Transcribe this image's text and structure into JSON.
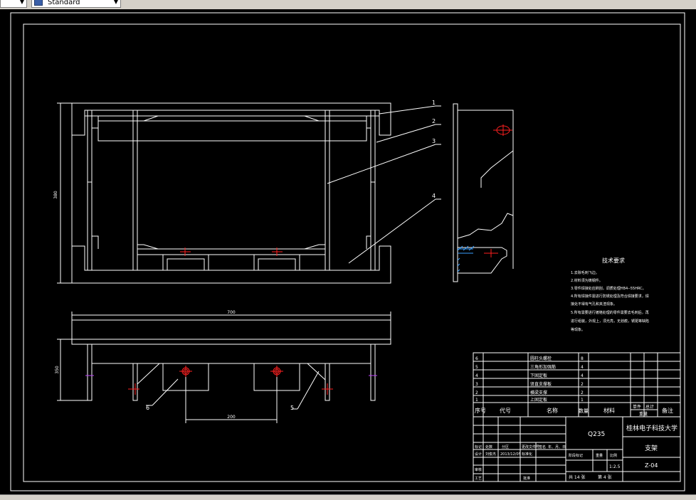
{
  "toolbar": {
    "style_dropdown_value": "Standard"
  },
  "drawing": {
    "part_labels": [
      "1",
      "2",
      "3",
      "4",
      "5",
      "6"
    ],
    "dimensions": {
      "height_top_view": "380",
      "total_length": "700",
      "side_height": "350",
      "hole_spacing": "200"
    },
    "tech_requirements": {
      "title": "技术要求",
      "lines": [
        "1.去除毛刺飞边。",
        "2.材料须为铸钢件。",
        "3.零件焊接处应刷刮，调质处理HB4--55HRC。",
        "4.所有焊接件需进行防锈处理及符合焊接要求，焊",
        "接处不得有气孔和夹渣现象。",
        "5.所有需要进行镀铬处理的零件需要去毛刺后，再",
        "进行组装，外观上，须光亮，无划痕，锈斑等缺陷",
        "等现象。"
      ]
    },
    "bom_rows": [
      {
        "no": "6",
        "name": "圆柱头螺栓",
        "qty": "8"
      },
      {
        "no": "5",
        "name": "三角形加强筋",
        "qty": "4"
      },
      {
        "no": "4",
        "name": "下固定板",
        "qty": "4"
      },
      {
        "no": "3",
        "name": "竖直支撑板",
        "qty": "2"
      },
      {
        "no": "2",
        "name": "横梁支撑",
        "qty": "2"
      },
      {
        "no": "1",
        "name": "上固定板",
        "qty": "1"
      }
    ],
    "bom_headers": {
      "no": "序号",
      "code": "代号",
      "name": "名称",
      "qty": "数量",
      "material": "材料",
      "unit_weight": "单件",
      "total_weight": "总计",
      "weight": "重量",
      "remark": "备注"
    },
    "title_block": {
      "material": "Q235",
      "school": "桂林电子科技大学",
      "part_name": "支架",
      "drawing_no": "Z-04",
      "scale_label": "比例",
      "scale": "1:2.5",
      "stage_label": "阶段标记",
      "weight_label": "重量",
      "sheets": "共 14 张",
      "sheet_no": "第 4 张",
      "rev_row": [
        "标记",
        "处数",
        "分区",
        "更改文件号",
        "签名",
        "年、月、日"
      ],
      "designer_row": [
        "设计",
        "刘俊杰",
        "2013/12/05",
        "标准化"
      ],
      "review_label": "审核",
      "process_label": "工艺",
      "approve_label": "批准"
    }
  }
}
